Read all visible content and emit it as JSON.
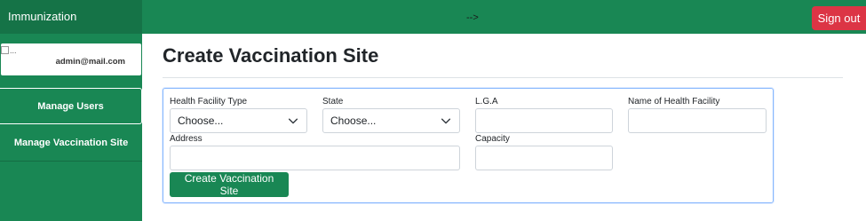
{
  "header": {
    "brand": "Immunization",
    "arrow_text": "-->",
    "signout_label": "Sign out"
  },
  "sidebar": {
    "user_email": "admin@mail.com",
    "broken_image_alt": "...",
    "items": [
      {
        "label": "Manage Users"
      },
      {
        "label": "Manage Vaccination Site"
      }
    ]
  },
  "main": {
    "title": "Create Vaccination Site",
    "form": {
      "facility_type": {
        "label": "Health Facility Type",
        "value": "Choose..."
      },
      "state": {
        "label": "State",
        "value": "Choose..."
      },
      "lga": {
        "label": "L.G.A",
        "value": ""
      },
      "facility_name": {
        "label": "Name of Health Facility",
        "value": ""
      },
      "address": {
        "label": "Address",
        "value": ""
      },
      "capacity": {
        "label": "Capacity",
        "value": ""
      },
      "submit_label": "Create Vaccination Site"
    }
  },
  "colors": {
    "primary_green": "#198754",
    "dark_green": "#157347",
    "danger_red": "#dc3545",
    "focus_blue": "#86b7fe"
  }
}
